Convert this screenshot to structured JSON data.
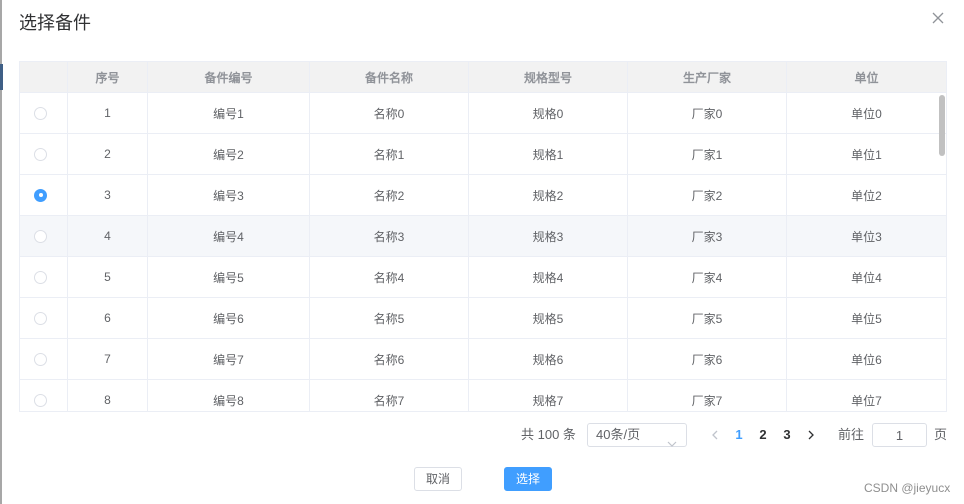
{
  "dialog": {
    "title": "选择备件",
    "close_icon": "close-icon"
  },
  "table": {
    "columns": [
      "",
      "序号",
      "备件编号",
      "备件名称",
      "规格型号",
      "生产厂家",
      "单位"
    ],
    "rows": [
      {
        "index": "1",
        "code": "编号1",
        "name": "名称0",
        "spec": "规格0",
        "maker": "厂家0",
        "unit": "单位0",
        "selected": false,
        "hovered": false
      },
      {
        "index": "2",
        "code": "编号2",
        "name": "名称1",
        "spec": "规格1",
        "maker": "厂家1",
        "unit": "单位1",
        "selected": false,
        "hovered": false
      },
      {
        "index": "3",
        "code": "编号3",
        "name": "名称2",
        "spec": "规格2",
        "maker": "厂家2",
        "unit": "单位2",
        "selected": true,
        "hovered": false
      },
      {
        "index": "4",
        "code": "编号4",
        "name": "名称3",
        "spec": "规格3",
        "maker": "厂家3",
        "unit": "单位3",
        "selected": false,
        "hovered": true
      },
      {
        "index": "5",
        "code": "编号5",
        "name": "名称4",
        "spec": "规格4",
        "maker": "厂家4",
        "unit": "单位4",
        "selected": false,
        "hovered": false
      },
      {
        "index": "6",
        "code": "编号6",
        "name": "名称5",
        "spec": "规格5",
        "maker": "厂家5",
        "unit": "单位5",
        "selected": false,
        "hovered": false
      },
      {
        "index": "7",
        "code": "编号7",
        "name": "名称6",
        "spec": "规格6",
        "maker": "厂家6",
        "unit": "单位6",
        "selected": false,
        "hovered": false
      },
      {
        "index": "8",
        "code": "编号8",
        "name": "名称7",
        "spec": "规格7",
        "maker": "厂家7",
        "unit": "单位7",
        "selected": false,
        "hovered": false
      }
    ]
  },
  "pagination": {
    "total_text": "共 100 条",
    "page_size": "40条/页",
    "pages": [
      "1",
      "2",
      "3"
    ],
    "current": "1",
    "goto_label": "前往",
    "goto_value": "1",
    "goto_suffix": "页",
    "icons": {
      "prev": "chevron-left-icon",
      "next": "chevron-right-icon",
      "select_arrow": "chevron-down-icon"
    }
  },
  "footer": {
    "cancel_label": "取消",
    "confirm_label": "选择"
  },
  "watermark": "CSDN @jieyucx",
  "colors": {
    "accent": "#409eff",
    "hover_row": "#f5f7fa",
    "header_bg": "#f2f2f2"
  }
}
